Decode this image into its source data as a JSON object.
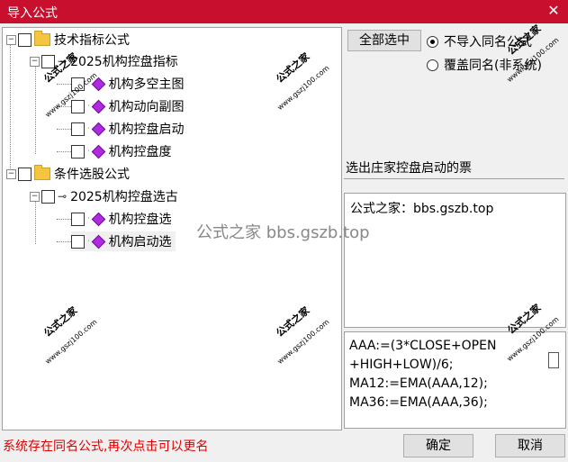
{
  "window": {
    "title": "导入公式",
    "close_glyph": "✕"
  },
  "tree": {
    "tech_group": "技术指标公式",
    "tech_sub": "2025机构控盘指标",
    "items": [
      "机构多空主图",
      "机构动向副图",
      "机构控盘启动",
      "机构控盘度"
    ],
    "select_group": "条件选股公式",
    "select_sub": "2025机构控盘选古",
    "select_items": [
      "机构控盘选",
      "机构启动选"
    ]
  },
  "buttons": {
    "select_all": "全部选中",
    "ok": "确定",
    "cancel": "取消"
  },
  "options": {
    "no_import": "不导入同名公式",
    "overwrite": "覆盖同名(非系统)"
  },
  "description": "选出庄家控盘启动的票",
  "site_box": "公式之家：bbs.gszb.top",
  "code": "AAA:=(3*CLOSE+OPEN\n+HIGH+LOW)/6;\nMA12:=EMA(AAA,12);\nMA36:=EMA(AAA,36);",
  "status": "系统存在同名公式,再次点击可以更名",
  "watermarks": {
    "center": "公式之家 bbs.gszb.top",
    "stamp": "公式之家",
    "url": "www.gszj100.com"
  }
}
